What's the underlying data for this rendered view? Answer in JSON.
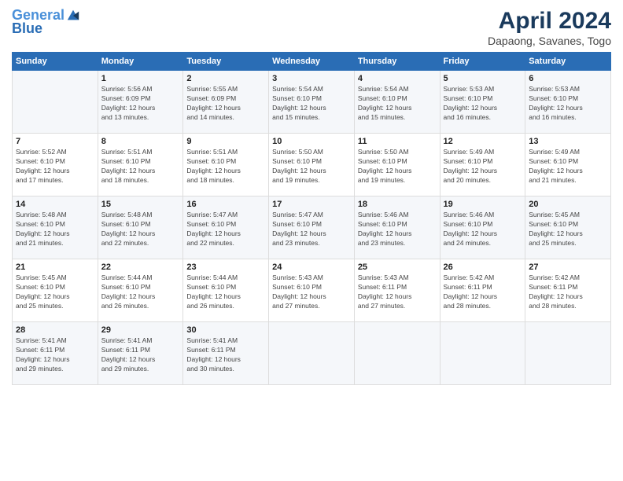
{
  "header": {
    "logo_line1": "General",
    "logo_line2": "Blue",
    "month": "April 2024",
    "location": "Dapaong, Savanes, Togo"
  },
  "weekdays": [
    "Sunday",
    "Monday",
    "Tuesday",
    "Wednesday",
    "Thursday",
    "Friday",
    "Saturday"
  ],
  "weeks": [
    [
      {
        "day": "",
        "info": ""
      },
      {
        "day": "1",
        "info": "Sunrise: 5:56 AM\nSunset: 6:09 PM\nDaylight: 12 hours\nand 13 minutes."
      },
      {
        "day": "2",
        "info": "Sunrise: 5:55 AM\nSunset: 6:09 PM\nDaylight: 12 hours\nand 14 minutes."
      },
      {
        "day": "3",
        "info": "Sunrise: 5:54 AM\nSunset: 6:10 PM\nDaylight: 12 hours\nand 15 minutes."
      },
      {
        "day": "4",
        "info": "Sunrise: 5:54 AM\nSunset: 6:10 PM\nDaylight: 12 hours\nand 15 minutes."
      },
      {
        "day": "5",
        "info": "Sunrise: 5:53 AM\nSunset: 6:10 PM\nDaylight: 12 hours\nand 16 minutes."
      },
      {
        "day": "6",
        "info": "Sunrise: 5:53 AM\nSunset: 6:10 PM\nDaylight: 12 hours\nand 16 minutes."
      }
    ],
    [
      {
        "day": "7",
        "info": "Sunrise: 5:52 AM\nSunset: 6:10 PM\nDaylight: 12 hours\nand 17 minutes."
      },
      {
        "day": "8",
        "info": "Sunrise: 5:51 AM\nSunset: 6:10 PM\nDaylight: 12 hours\nand 18 minutes."
      },
      {
        "day": "9",
        "info": "Sunrise: 5:51 AM\nSunset: 6:10 PM\nDaylight: 12 hours\nand 18 minutes."
      },
      {
        "day": "10",
        "info": "Sunrise: 5:50 AM\nSunset: 6:10 PM\nDaylight: 12 hours\nand 19 minutes."
      },
      {
        "day": "11",
        "info": "Sunrise: 5:50 AM\nSunset: 6:10 PM\nDaylight: 12 hours\nand 19 minutes."
      },
      {
        "day": "12",
        "info": "Sunrise: 5:49 AM\nSunset: 6:10 PM\nDaylight: 12 hours\nand 20 minutes."
      },
      {
        "day": "13",
        "info": "Sunrise: 5:49 AM\nSunset: 6:10 PM\nDaylight: 12 hours\nand 21 minutes."
      }
    ],
    [
      {
        "day": "14",
        "info": "Sunrise: 5:48 AM\nSunset: 6:10 PM\nDaylight: 12 hours\nand 21 minutes."
      },
      {
        "day": "15",
        "info": "Sunrise: 5:48 AM\nSunset: 6:10 PM\nDaylight: 12 hours\nand 22 minutes."
      },
      {
        "day": "16",
        "info": "Sunrise: 5:47 AM\nSunset: 6:10 PM\nDaylight: 12 hours\nand 22 minutes."
      },
      {
        "day": "17",
        "info": "Sunrise: 5:47 AM\nSunset: 6:10 PM\nDaylight: 12 hours\nand 23 minutes."
      },
      {
        "day": "18",
        "info": "Sunrise: 5:46 AM\nSunset: 6:10 PM\nDaylight: 12 hours\nand 23 minutes."
      },
      {
        "day": "19",
        "info": "Sunrise: 5:46 AM\nSunset: 6:10 PM\nDaylight: 12 hours\nand 24 minutes."
      },
      {
        "day": "20",
        "info": "Sunrise: 5:45 AM\nSunset: 6:10 PM\nDaylight: 12 hours\nand 25 minutes."
      }
    ],
    [
      {
        "day": "21",
        "info": "Sunrise: 5:45 AM\nSunset: 6:10 PM\nDaylight: 12 hours\nand 25 minutes."
      },
      {
        "day": "22",
        "info": "Sunrise: 5:44 AM\nSunset: 6:10 PM\nDaylight: 12 hours\nand 26 minutes."
      },
      {
        "day": "23",
        "info": "Sunrise: 5:44 AM\nSunset: 6:10 PM\nDaylight: 12 hours\nand 26 minutes."
      },
      {
        "day": "24",
        "info": "Sunrise: 5:43 AM\nSunset: 6:10 PM\nDaylight: 12 hours\nand 27 minutes."
      },
      {
        "day": "25",
        "info": "Sunrise: 5:43 AM\nSunset: 6:11 PM\nDaylight: 12 hours\nand 27 minutes."
      },
      {
        "day": "26",
        "info": "Sunrise: 5:42 AM\nSunset: 6:11 PM\nDaylight: 12 hours\nand 28 minutes."
      },
      {
        "day": "27",
        "info": "Sunrise: 5:42 AM\nSunset: 6:11 PM\nDaylight: 12 hours\nand 28 minutes."
      }
    ],
    [
      {
        "day": "28",
        "info": "Sunrise: 5:41 AM\nSunset: 6:11 PM\nDaylight: 12 hours\nand 29 minutes."
      },
      {
        "day": "29",
        "info": "Sunrise: 5:41 AM\nSunset: 6:11 PM\nDaylight: 12 hours\nand 29 minutes."
      },
      {
        "day": "30",
        "info": "Sunrise: 5:41 AM\nSunset: 6:11 PM\nDaylight: 12 hours\nand 30 minutes."
      },
      {
        "day": "",
        "info": ""
      },
      {
        "day": "",
        "info": ""
      },
      {
        "day": "",
        "info": ""
      },
      {
        "day": "",
        "info": ""
      }
    ]
  ]
}
